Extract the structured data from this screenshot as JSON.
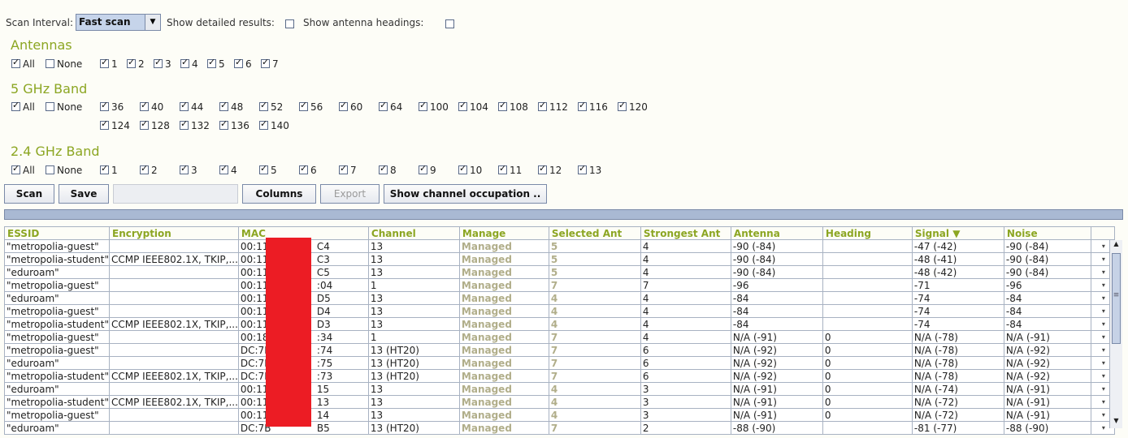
{
  "controls": {
    "scan_interval_label": "Scan Interval:",
    "scan_interval_value": "Fast scan",
    "detailed_label": "Show detailed results:",
    "detailed_checked": false,
    "headings_label": "Show antenna headings:",
    "headings_checked": false
  },
  "antennas": {
    "title": "Antennas",
    "all": "All",
    "none": "None",
    "items": [
      "1",
      "2",
      "3",
      "4",
      "5",
      "6",
      "7"
    ]
  },
  "band5": {
    "title": "5 GHz Band",
    "all": "All",
    "none": "None",
    "row1": [
      "36",
      "40",
      "44",
      "48",
      "52",
      "56",
      "60",
      "64",
      "100",
      "104",
      "108",
      "112",
      "116",
      "120"
    ],
    "row2": [
      "124",
      "128",
      "132",
      "136",
      "140"
    ]
  },
  "band24": {
    "title": "2.4 GHz Band",
    "all": "All",
    "none": "None",
    "items": [
      "1",
      "2",
      "3",
      "4",
      "5",
      "6",
      "7",
      "8",
      "9",
      "10",
      "11",
      "12",
      "13"
    ]
  },
  "buttons": {
    "scan": "Scan",
    "save": "Save",
    "columns": "Columns",
    "export": "Export",
    "occupation": "Show channel occupation .."
  },
  "table": {
    "columns": [
      "ESSID",
      "Encryption",
      "MAC",
      "Channel",
      "Manage",
      "Selected Ant",
      "Strongest Ant",
      "Antenna",
      "Heading",
      "Signal",
      "Noise"
    ],
    "sort_indicator": "▼",
    "rows": [
      [
        "\"metropolia-guest\"",
        "",
        "00:11:",
        "C4",
        "13",
        "Managed",
        "5",
        "4",
        "-90 (-84)",
        "",
        "-47 (-42)",
        "-90 (-84)"
      ],
      [
        "\"metropolia-student\"",
        "CCMP IEEE802.1X, TKIP,...",
        "00:11:",
        "C3",
        "13",
        "Managed",
        "5",
        "4",
        "-90 (-84)",
        "",
        "-48 (-41)",
        "-90 (-84)"
      ],
      [
        "\"eduroam\"",
        "",
        "00:11:",
        "C5",
        "13",
        "Managed",
        "5",
        "4",
        "-90 (-84)",
        "",
        "-48 (-42)",
        "-90 (-84)"
      ],
      [
        "\"metropolia-guest\"",
        "",
        "00:11:",
        ":04",
        "1",
        "Managed",
        "7",
        "7",
        "-96",
        "",
        "-71",
        "-96"
      ],
      [
        "\"eduroam\"",
        "",
        "00:11:",
        "D5",
        "13",
        "Managed",
        "4",
        "4",
        "-84",
        "",
        "-74",
        "-84"
      ],
      [
        "\"metropolia-guest\"",
        "",
        "00:11:",
        "D4",
        "13",
        "Managed",
        "4",
        "4",
        "-84",
        "",
        "-74",
        "-84"
      ],
      [
        "\"metropolia-student\"",
        "CCMP IEEE802.1X, TKIP,...",
        "00:11:",
        "D3",
        "13",
        "Managed",
        "4",
        "4",
        "-84",
        "",
        "-74",
        "-84"
      ],
      [
        "\"metropolia-guest\"",
        "",
        "00:18:",
        ":34",
        "1",
        "Managed",
        "7",
        "4",
        "N/A (-91)",
        "0",
        "N/A (-78)",
        "N/A (-91)"
      ],
      [
        "\"metropolia-guest\"",
        "",
        "DC:7B",
        ":74",
        "13 (HT20)",
        "Managed",
        "7",
        "6",
        "N/A (-92)",
        "0",
        "N/A (-78)",
        "N/A (-92)"
      ],
      [
        "\"eduroam\"",
        "",
        "DC:7B",
        ":75",
        "13 (HT20)",
        "Managed",
        "7",
        "6",
        "N/A (-92)",
        "0",
        "N/A (-78)",
        "N/A (-92)"
      ],
      [
        "\"metropolia-student\"",
        "CCMP IEEE802.1X, TKIP,...",
        "DC:7B",
        ":73",
        "13 (HT20)",
        "Managed",
        "7",
        "6",
        "N/A (-92)",
        "0",
        "N/A (-78)",
        "N/A (-92)"
      ],
      [
        "\"eduroam\"",
        "",
        "00:11:",
        "15",
        "13",
        "Managed",
        "4",
        "3",
        "N/A (-91)",
        "0",
        "N/A (-74)",
        "N/A (-91)"
      ],
      [
        "\"metropolia-student\"",
        "CCMP IEEE802.1X, TKIP,...",
        "00:11:",
        "13",
        "13",
        "Managed",
        "4",
        "3",
        "N/A (-91)",
        "0",
        "N/A (-72)",
        "N/A (-91)"
      ],
      [
        "\"metropolia-guest\"",
        "",
        "00:11:",
        "14",
        "13",
        "Managed",
        "4",
        "3",
        "N/A (-91)",
        "0",
        "N/A (-72)",
        "N/A (-91)"
      ],
      [
        "\"eduroam\"",
        "",
        "DC:7B",
        "B5",
        "13 (HT20)",
        "Managed",
        "7",
        "2",
        "-88 (-90)",
        "",
        "-81 (-77)",
        "-88 (-90)"
      ]
    ]
  }
}
